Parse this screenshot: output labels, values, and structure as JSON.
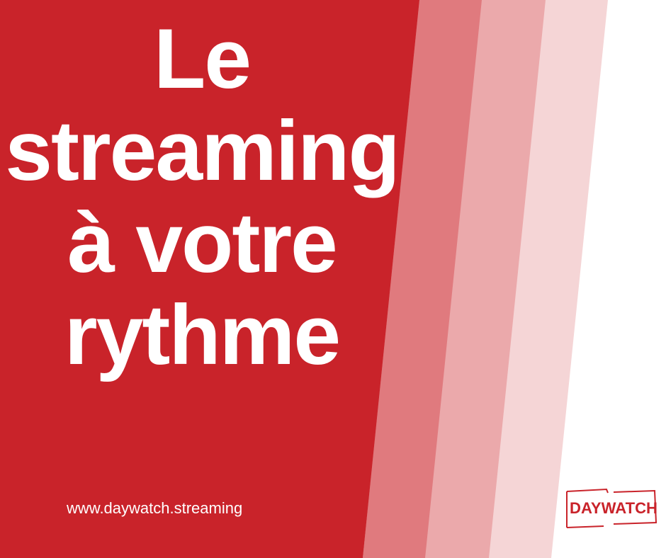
{
  "headline": {
    "line1": "Le",
    "line2": "streaming",
    "line3": "à votre",
    "line4": "rythme"
  },
  "footer": {
    "url": "www.daywatch.streaming"
  },
  "brand": {
    "logo_text": "DAYWATCH"
  },
  "colors": {
    "primary_red": "#c9232a",
    "stripe_1": "#e07a7e",
    "stripe_2": "#eba9ab",
    "stripe_3": "#f5d5d6",
    "text_on_red": "#ffffff",
    "logo_red": "#c9232a"
  }
}
